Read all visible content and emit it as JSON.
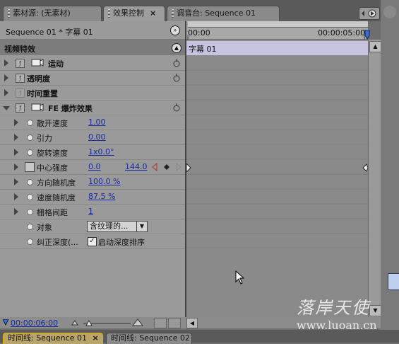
{
  "tabs": [
    {
      "label": "素材源: (无素材)",
      "active": false
    },
    {
      "label": "效果控制",
      "active": true,
      "close": "×"
    },
    {
      "label": "调音台: Sequence 01",
      "active": false
    }
  ],
  "panel": {
    "sequence_title": "Sequence 01 * 字幕 01",
    "section_header": "视频特效",
    "timecode_start": "00:00",
    "timecode_end": "00:00:05:00",
    "clip_name": "字幕 01"
  },
  "effects": [
    {
      "label": "运动",
      "has_film": true
    },
    {
      "label": "透明度",
      "has_film": false
    },
    {
      "label": "时间重置",
      "has_film": false,
      "disabled": true
    },
    {
      "label": "FE 爆炸效果",
      "has_film": true
    }
  ],
  "params": [
    {
      "label": "散开速度",
      "value": "1.00"
    },
    {
      "label": "引力",
      "value": "0.00"
    },
    {
      "label": "旋转速度",
      "value": "1x0.0°"
    },
    {
      "label": "中心强度",
      "value": "0.0",
      "value2": "144.0"
    },
    {
      "label": "方向随机度",
      "value": "100.0 %"
    },
    {
      "label": "速度随机度",
      "value": "87.5 %"
    },
    {
      "label": "栅格间距",
      "value": "1"
    },
    {
      "label": "对象",
      "dropdown": "含纹理的..."
    },
    {
      "label": "纠正深度(...",
      "checkbox_label": "启动深度排序"
    }
  ],
  "footer": {
    "timecode": "00:00:06:00"
  },
  "bottom_tabs": [
    {
      "label": "时间线: Sequence 01",
      "active": true,
      "close": "×"
    },
    {
      "label": "时间线: Sequence 02",
      "active": false
    }
  ],
  "watermark": {
    "line1": "落岸天使",
    "line2": "www.luoan.cn"
  }
}
